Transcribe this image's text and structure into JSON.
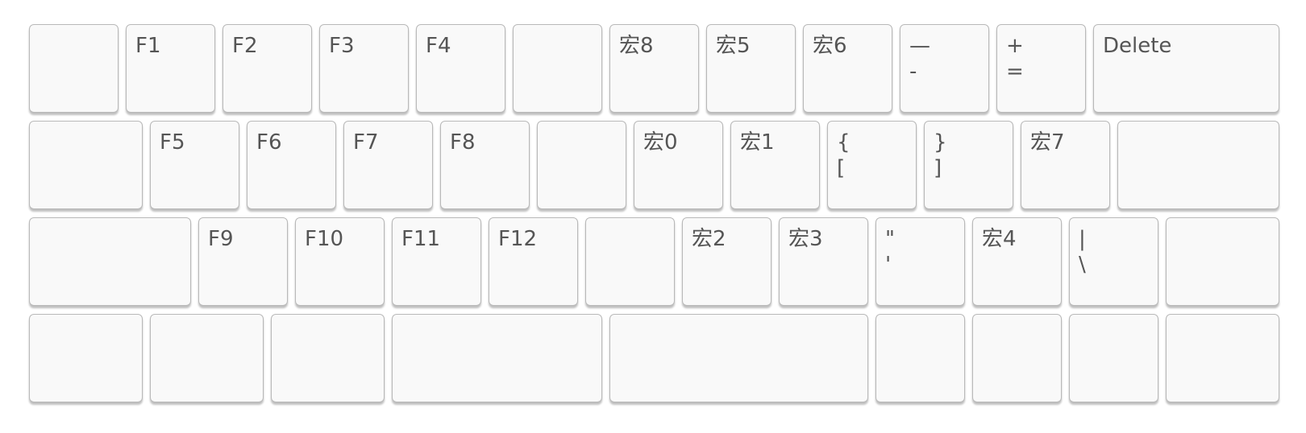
{
  "keyboard": {
    "rows": [
      {
        "keys": [
          {
            "top": "",
            "bottom": ""
          },
          {
            "top": "F1",
            "bottom": ""
          },
          {
            "top": "F2",
            "bottom": ""
          },
          {
            "top": "F3",
            "bottom": ""
          },
          {
            "top": "F4",
            "bottom": ""
          },
          {
            "top": "",
            "bottom": ""
          },
          {
            "top": "宏8",
            "bottom": ""
          },
          {
            "top": "宏5",
            "bottom": ""
          },
          {
            "top": "宏6",
            "bottom": ""
          },
          {
            "top": "—",
            "bottom": "-"
          },
          {
            "top": "+",
            "bottom": "="
          },
          {
            "top": "Delete",
            "bottom": ""
          }
        ]
      },
      {
        "keys": [
          {
            "top": "",
            "bottom": ""
          },
          {
            "top": "F5",
            "bottom": ""
          },
          {
            "top": "F6",
            "bottom": ""
          },
          {
            "top": "F7",
            "bottom": ""
          },
          {
            "top": "F8",
            "bottom": ""
          },
          {
            "top": "",
            "bottom": ""
          },
          {
            "top": "宏0",
            "bottom": ""
          },
          {
            "top": "宏1",
            "bottom": ""
          },
          {
            "top": "{",
            "bottom": "["
          },
          {
            "top": "}",
            "bottom": "]"
          },
          {
            "top": "宏7",
            "bottom": ""
          },
          {
            "top": "",
            "bottom": ""
          }
        ]
      },
      {
        "keys": [
          {
            "top": "",
            "bottom": ""
          },
          {
            "top": "F9",
            "bottom": ""
          },
          {
            "top": "F10",
            "bottom": ""
          },
          {
            "top": "F11",
            "bottom": ""
          },
          {
            "top": "F12",
            "bottom": ""
          },
          {
            "top": "",
            "bottom": ""
          },
          {
            "top": "宏2",
            "bottom": ""
          },
          {
            "top": "宏3",
            "bottom": ""
          },
          {
            "top": "\"",
            "bottom": "'"
          },
          {
            "top": "宏4",
            "bottom": ""
          },
          {
            "top": "|",
            "bottom": "\\"
          },
          {
            "top": "",
            "bottom": ""
          }
        ]
      },
      {
        "keys": [
          {
            "top": "",
            "bottom": ""
          },
          {
            "top": "",
            "bottom": ""
          },
          {
            "top": "",
            "bottom": ""
          },
          {
            "top": "",
            "bottom": ""
          },
          {
            "top": "",
            "bottom": ""
          },
          {
            "top": "",
            "bottom": ""
          },
          {
            "top": "",
            "bottom": ""
          },
          {
            "top": "",
            "bottom": ""
          },
          {
            "top": "",
            "bottom": ""
          }
        ]
      }
    ]
  }
}
